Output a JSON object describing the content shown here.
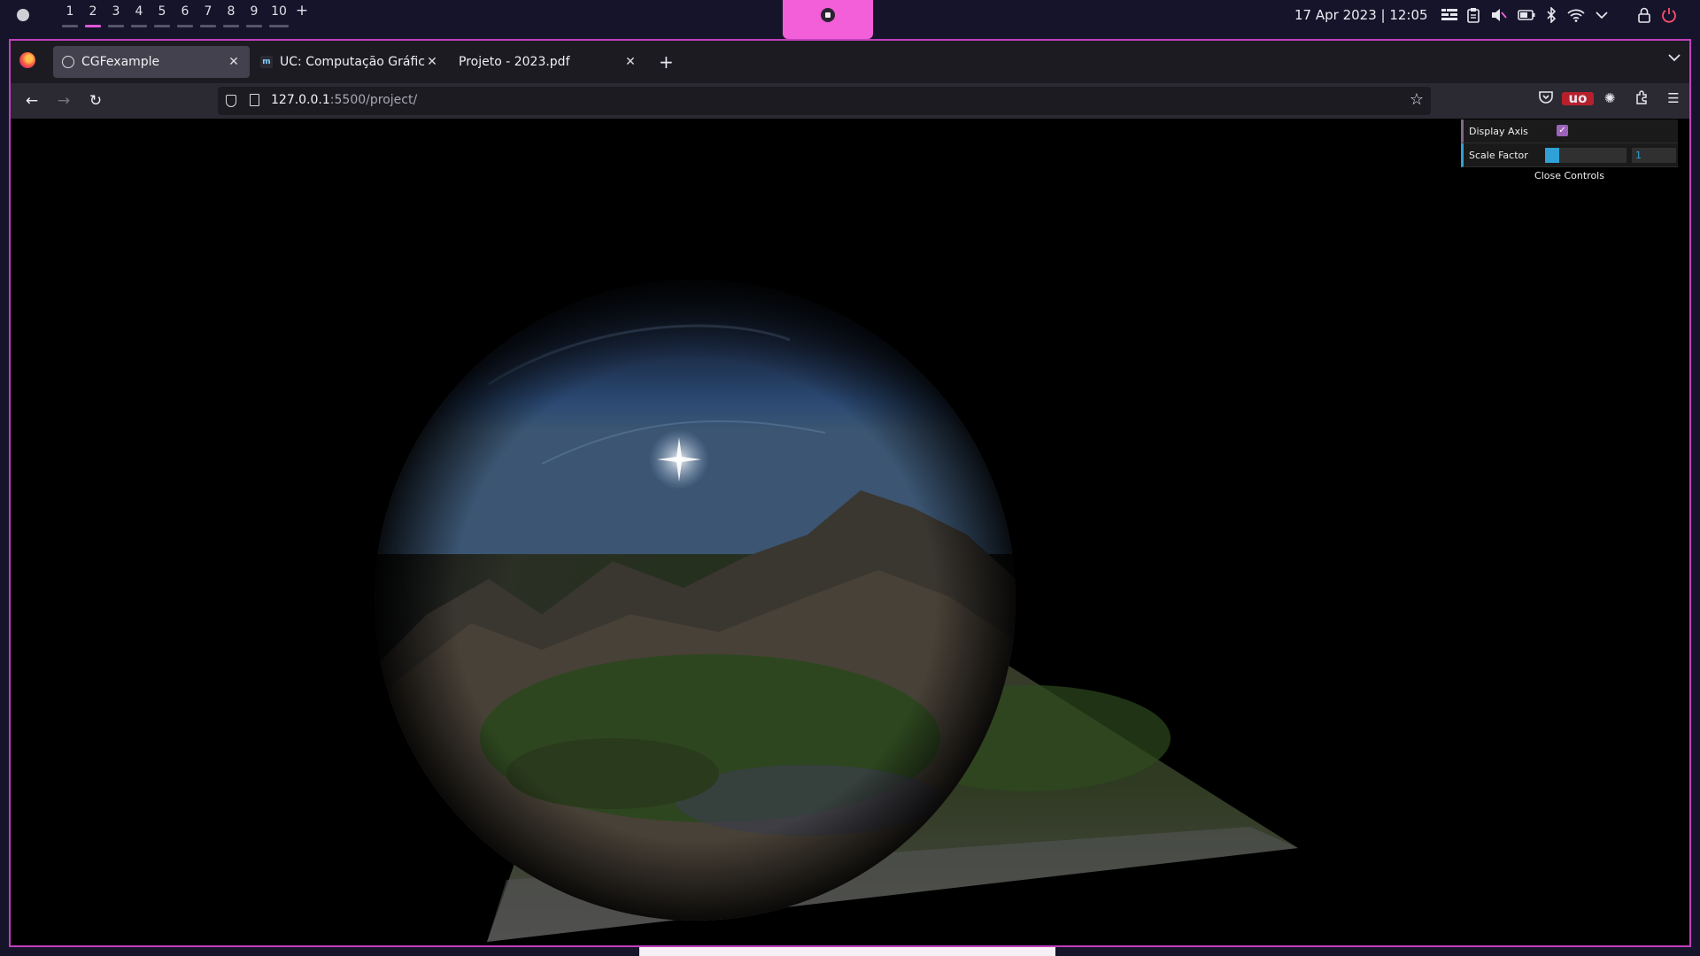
{
  "system_bar": {
    "workspaces": [
      "1",
      "2",
      "3",
      "4",
      "5",
      "6",
      "7",
      "8",
      "9",
      "10"
    ],
    "active_workspace": "2",
    "add_workspace": "+",
    "clock": "17 Apr 2023 | 12:05",
    "tray_icons": [
      "grid-icon",
      "clipboard-icon",
      "volume-muted-icon",
      "battery-icon",
      "bluetooth-icon",
      "wifi-icon",
      "chevron-down-icon",
      "lock-icon",
      "power-icon"
    ],
    "accent": "#f25fd9"
  },
  "browser": {
    "tabs": [
      {
        "title": "CGFexample",
        "active": true,
        "favicon": "globe-icon"
      },
      {
        "title": "UC: Computação Gráfica",
        "active": false,
        "favicon": "moodle-icon"
      },
      {
        "title": "Projeto - 2023.pdf",
        "active": false,
        "favicon": "none"
      }
    ],
    "new_tab": "+",
    "url_host": "127.0.0.1",
    "url_path": ":5500/project/",
    "toolbar_icons": [
      "pocket-icon",
      "ublock-icon",
      "extension-gear-icon",
      "extensions-icon",
      "menu-icon"
    ],
    "ublock_label": "uo"
  },
  "gui": {
    "display_axis_label": "Display Axis",
    "display_axis_checked": true,
    "scale_factor_label": "Scale Factor",
    "scale_factor_value": "1",
    "close_label": "Close Controls"
  }
}
